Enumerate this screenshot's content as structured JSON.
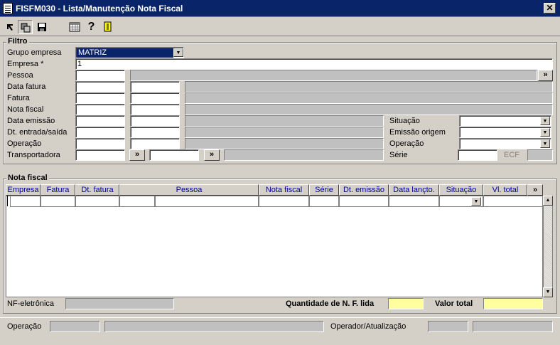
{
  "window": {
    "title": "FISFM030 - Lista/Manutenção Nota Fiscal",
    "close": "✕"
  },
  "toolbar": {
    "icons": [
      "arrow-icon",
      "copy-icon",
      "save-icon",
      "calendar-icon",
      "help-icon",
      "exit-icon"
    ],
    "help": "?"
  },
  "filtro": {
    "legend": "Filtro",
    "grupo_empresa": {
      "label": "Grupo empresa",
      "value": "MATRIZ"
    },
    "empresa": {
      "label": "Empresa *",
      "value": "1"
    },
    "pessoa": {
      "label": "Pessoa"
    },
    "data_fatura": {
      "label": "Data fatura"
    },
    "fatura": {
      "label": "Fatura"
    },
    "nota_fiscal": {
      "label": "Nota fiscal"
    },
    "data_emissao": {
      "label": "Data emissão"
    },
    "dt_entrada_saida": {
      "label": "Dt. entrada/saída"
    },
    "operacao": {
      "label": "Operação"
    },
    "transportadora": {
      "label": "Transportadora"
    },
    "situacao": {
      "label": "Situação"
    },
    "emissao_origem": {
      "label": "Emissão origem"
    },
    "operacao2": {
      "label": "Operação"
    },
    "serie": {
      "label": "Série"
    },
    "ecf": {
      "label": "ECF"
    },
    "more": "»"
  },
  "nota_fiscal": {
    "legend": "Nota fiscal",
    "columns": [
      "Empresa",
      "Fatura",
      "Dt. fatura",
      "Pessoa",
      "Nota fiscal",
      "Série",
      "Dt. emissão",
      "Data lançto.",
      "Situação",
      "Vl. total"
    ],
    "more": "»"
  },
  "footer": {
    "nf_eletronica": "NF-eletrônica",
    "quantidade": "Quantidade de N. F. lida",
    "valor_total": "Valor total",
    "operacao": "Operação",
    "operador": "Operador/Atualização"
  }
}
